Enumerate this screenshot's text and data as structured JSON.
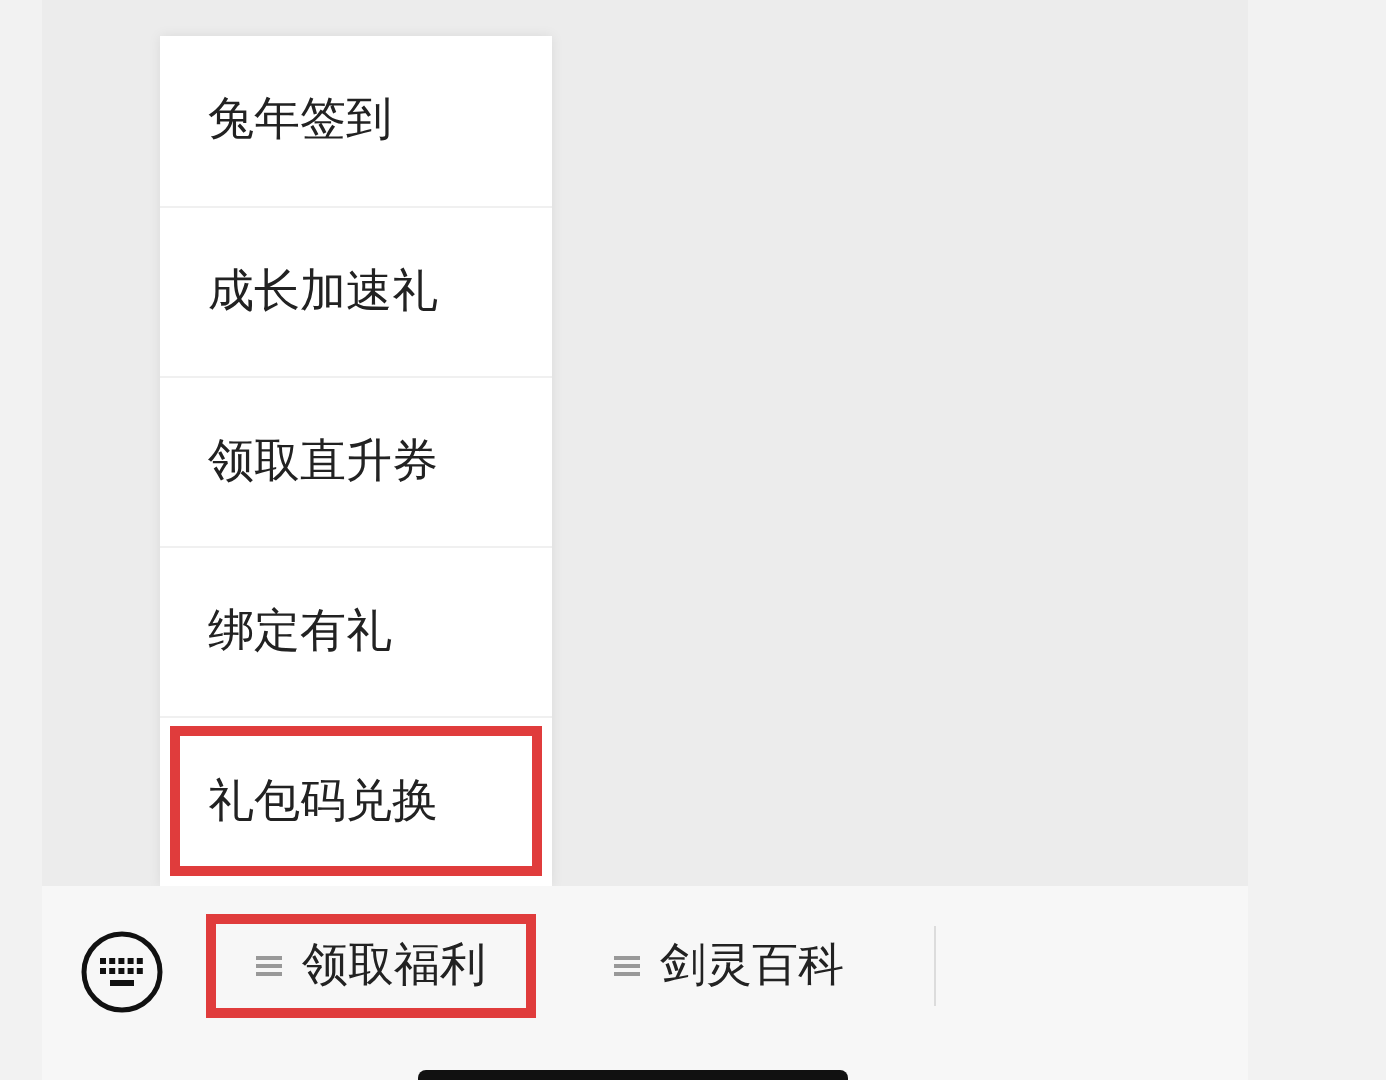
{
  "menu": {
    "items": [
      {
        "label": "兔年签到",
        "highlighted": false
      },
      {
        "label": "成长加速礼",
        "highlighted": false
      },
      {
        "label": "领取直升券",
        "highlighted": false
      },
      {
        "label": "绑定有礼",
        "highlighted": false
      },
      {
        "label": "礼包码兑换",
        "highlighted": true
      }
    ]
  },
  "bottom_menu": {
    "tabs": [
      {
        "label": "领取福利",
        "highlighted": true
      },
      {
        "label": "剑灵百科",
        "highlighted": false
      }
    ]
  }
}
